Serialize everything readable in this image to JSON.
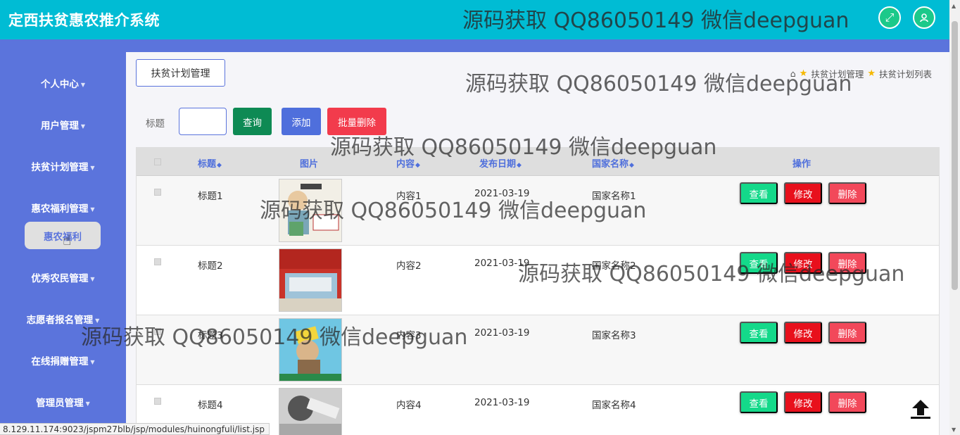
{
  "app": {
    "title": "定西扶贫惠农推介系统"
  },
  "header": {
    "fullscreen_icon": "⤢",
    "user_icon": "👤"
  },
  "sidebar": {
    "items": [
      {
        "label": "个人中心"
      },
      {
        "label": "用户管理"
      },
      {
        "label": "扶贫计划管理"
      },
      {
        "label": "惠农福利管理"
      },
      {
        "label": "优秀农民管理"
      },
      {
        "label": "志愿者报名管理"
      },
      {
        "label": "在线捐赠管理"
      },
      {
        "label": "管理员管理"
      }
    ],
    "active_sub": "惠农福利"
  },
  "page": {
    "section_button": "扶贫计划管理",
    "breadcrumb": [
      "扶贫计划管理",
      "扶贫计划列表"
    ]
  },
  "search": {
    "label": "标题",
    "value": "",
    "query_label": "查询",
    "add_label": "添加",
    "batch_delete_label": "批量删除"
  },
  "table": {
    "headers": {
      "title": "标题",
      "image": "图片",
      "content": "内容",
      "date": "发布日期",
      "country": "国家名称",
      "actions": "操作"
    },
    "rows": [
      {
        "title": "标题1",
        "content": "内容1",
        "date": "2021-03-19",
        "country": "国家名称1"
      },
      {
        "title": "标题2",
        "content": "内容2",
        "date": "2021-03-19",
        "country": "国家名称2"
      },
      {
        "title": "标题3",
        "content": "内容3",
        "date": "2021-03-19",
        "country": "国家名称3"
      },
      {
        "title": "标题4",
        "content": "内容4",
        "date": "2021-03-19",
        "country": "国家名称4"
      }
    ],
    "action_labels": {
      "view": "查看",
      "edit": "修改",
      "delete": "删除"
    }
  },
  "watermark_text": "源码获取 QQ86050149 微信deepguan",
  "status_url": "8.129.11.174:9023/jspm27blb/jsp/modules/huinongfuli/list.jsp",
  "colors": {
    "topbar": "#00bcd4",
    "sidebar": "#5b74dc",
    "view": "#14d98a",
    "edit": "#e8101c",
    "delete": "#f2485a"
  }
}
